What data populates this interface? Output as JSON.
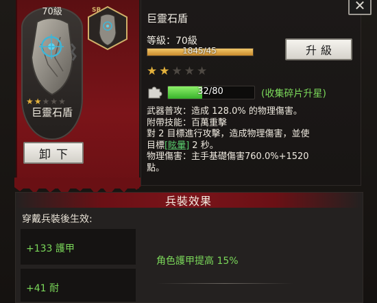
{
  "window": {
    "close_label": "✕"
  },
  "equipment": {
    "level": "70級",
    "name": "巨靈石盾",
    "stars_filled": 2,
    "stars_total": 5,
    "rarity_badge": "SR",
    "unequip_label": "卸下"
  },
  "detail": {
    "title": "巨靈石盾",
    "level_label": "等級：70級",
    "exp_text": "1845/45",
    "exp_progress": 1.0,
    "upgrade_label": "升級",
    "stars_filled": 2,
    "stars_total": 5,
    "fragments_text": "32/80",
    "fragments_progress": 0.4,
    "fragments_hint": "(收集碎片升星)",
    "desc_line1": "武器普攻：造成 128.0% 的物理傷害。",
    "desc_line2": "附帶技能：百萬重擊",
    "desc_line3": "對 2 目標進行攻擊，造成物理傷害，並使",
    "desc_line4_pre": "目標",
    "desc_line4_link": "[眩暈]",
    "desc_line4_post": " 2 秒。",
    "desc_line5": "物理傷害：主手基礎傷害760.0%+1520",
    "desc_line6": "點。"
  },
  "effects": {
    "section_title": "兵裝效果",
    "wear_label": "穿戴兵裝後生效:",
    "stat_1": "+133 護甲",
    "stat_2": "+41 耐",
    "effect_1": "角色護甲提高 15%"
  },
  "colors": {
    "accent_green": "#7bd95a",
    "panel_red": "#7b1419",
    "star_gold": "#e3b13c"
  }
}
